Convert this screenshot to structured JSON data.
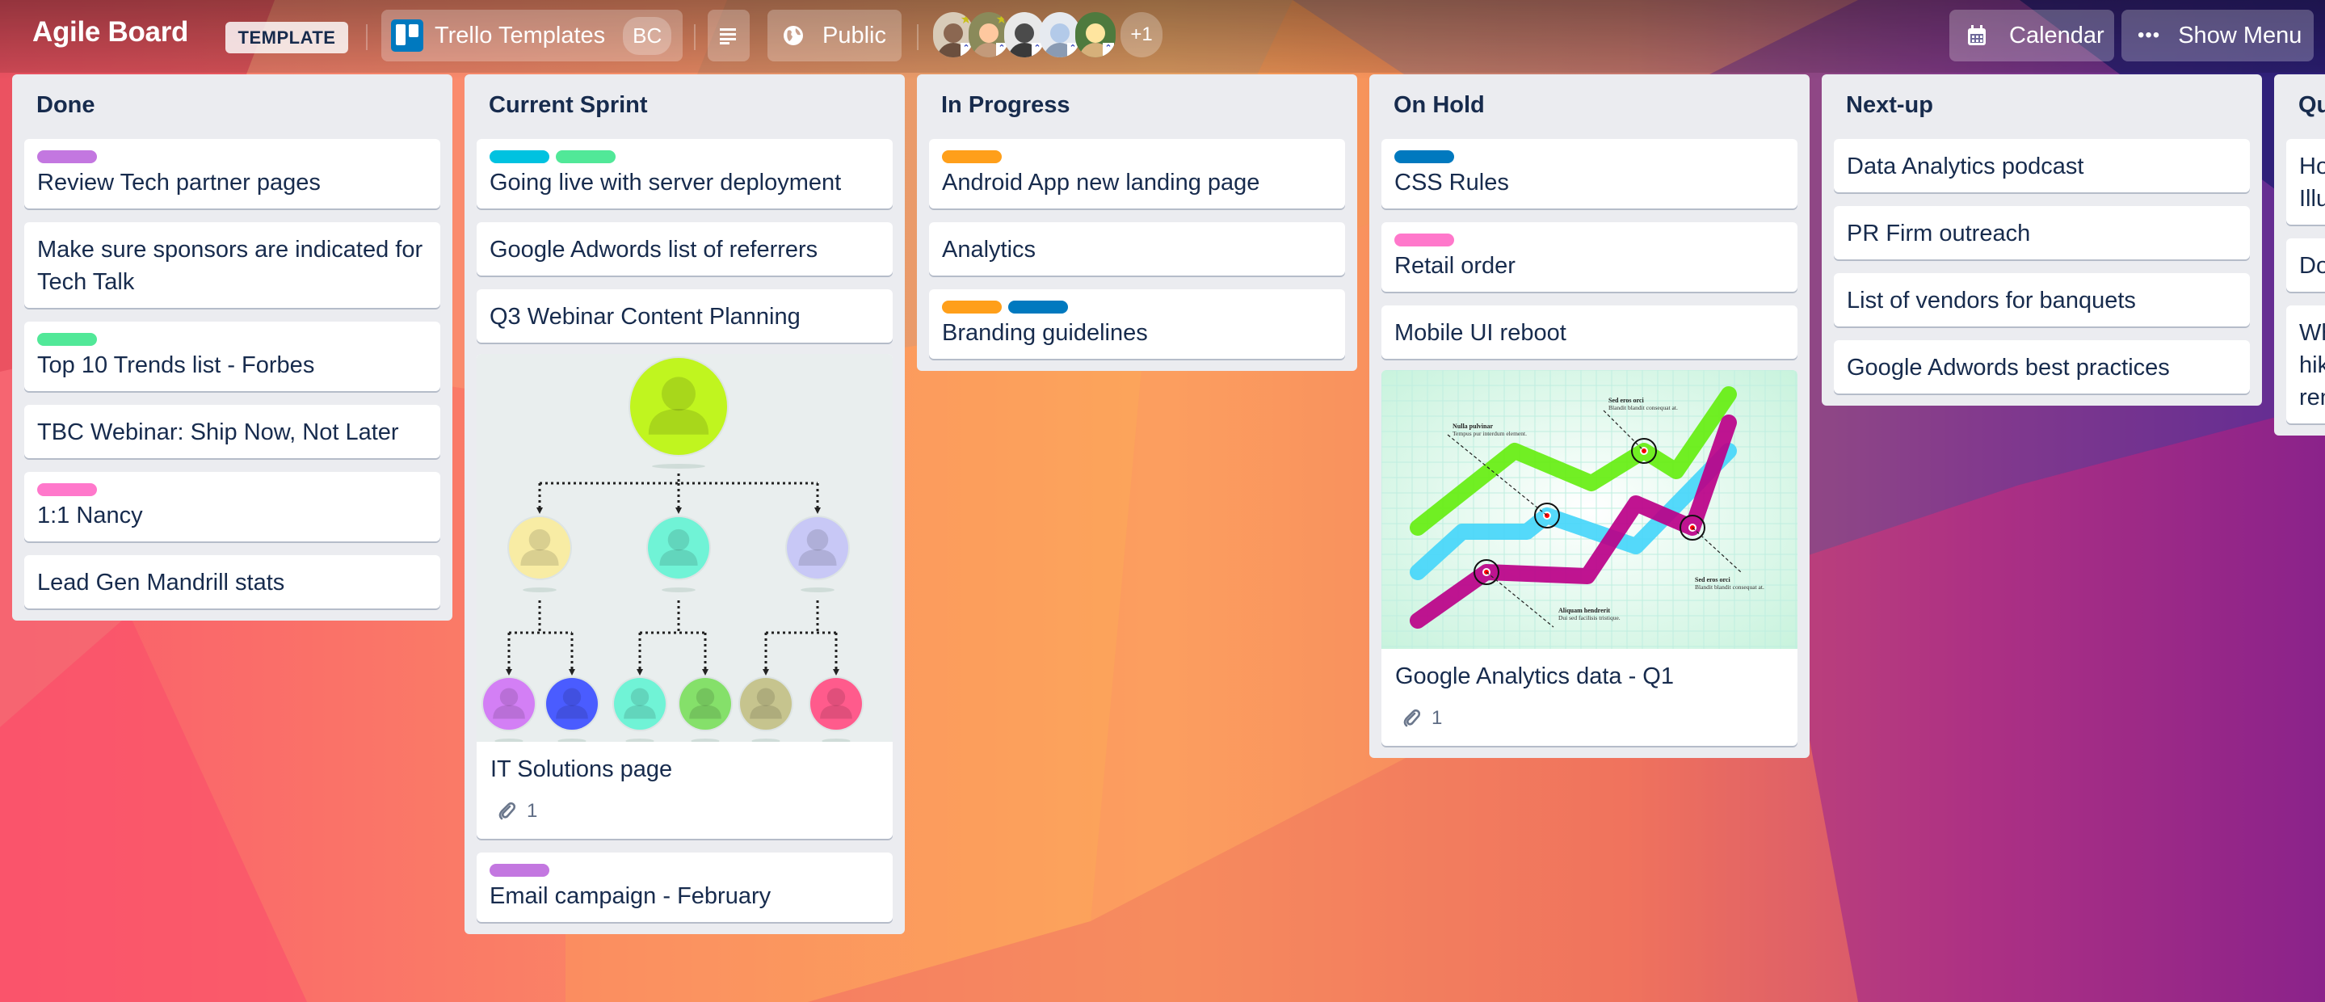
{
  "header": {
    "board_title": "Agile Board",
    "template_badge": "TEMPLATE",
    "workspace": {
      "name": "Trello Templates",
      "badge": "BC",
      "icon": "trello-logo-icon"
    },
    "menu_icon": "list-lines-icon",
    "visibility": {
      "label": "Public",
      "icon": "globe-icon"
    },
    "members": [
      {
        "name": "member-1",
        "admin": true,
        "face_color": "#6b4f3e",
        "bg": "#d8cbb8"
      },
      {
        "name": "member-2",
        "admin": true,
        "face_color": "#c39a7a",
        "bg": "#8a8a5a"
      },
      {
        "name": "member-3",
        "admin": false,
        "face_color": "#3a3a3a",
        "bg": "#e8e8e8"
      },
      {
        "name": "member-4",
        "admin": false,
        "face_color": "#8a9bb3",
        "bg": "#e6eaf0"
      },
      {
        "name": "member-5",
        "admin": false,
        "face_color": "#d6b07a",
        "bg": "#4e7a3e"
      }
    ],
    "members_overflow": "+1",
    "calendar": {
      "label": "Calendar",
      "icon": "calendar-icon"
    },
    "show_menu": {
      "label": "Show Menu",
      "icon": "ellipsis-icon"
    }
  },
  "label_colors": {
    "purple": "#c377e0",
    "green": "#51e898",
    "sky": "#00c2e0",
    "orange": "#ff9f1a",
    "blue": "#0079bf",
    "pink": "#ff78cb"
  },
  "lists": [
    {
      "title": "Done",
      "cards": [
        {
          "title": "Review Tech partner pages",
          "labels": [
            "purple"
          ]
        },
        {
          "title": "Make sure sponsors are indicated for Tech Talk",
          "labels": []
        },
        {
          "title": "Top 10 Trends list - Forbes",
          "labels": [
            "green"
          ]
        },
        {
          "title": "TBC Webinar: Ship Now, Not Later",
          "labels": []
        },
        {
          "title": "1:1 Nancy",
          "labels": [
            "pink"
          ]
        },
        {
          "title": "Lead Gen Mandrill stats",
          "labels": []
        }
      ]
    },
    {
      "title": "Current Sprint",
      "cards": [
        {
          "title": "Going live with server deployment",
          "labels": [
            "sky",
            "green"
          ]
        },
        {
          "title": "Google Adwords list of referrers",
          "labels": []
        },
        {
          "title": "Q3 Webinar Content Planning",
          "labels": []
        },
        {
          "title": "IT Solutions page",
          "labels": [],
          "cover": "org-chart",
          "attachments": "1"
        },
        {
          "title": "Email campaign - February",
          "labels": [
            "purple"
          ]
        }
      ]
    },
    {
      "title": "In Progress",
      "cards": [
        {
          "title": "Android App new landing page",
          "labels": [
            "orange"
          ]
        },
        {
          "title": "Analytics",
          "labels": []
        },
        {
          "title": "Branding guidelines",
          "labels": [
            "orange",
            "blue"
          ]
        }
      ]
    },
    {
      "title": "On Hold",
      "cards": [
        {
          "title": "CSS Rules",
          "labels": [
            "blue"
          ]
        },
        {
          "title": "Retail order",
          "labels": [
            "pink"
          ]
        },
        {
          "title": "Mobile UI reboot",
          "labels": []
        },
        {
          "title": "Google Analytics data - Q1",
          "labels": [],
          "cover": "line-chart",
          "attachments": "1"
        }
      ]
    },
    {
      "title": "Next-up",
      "cards": [
        {
          "title": "Data Analytics podcast",
          "labels": []
        },
        {
          "title": "PR Firm outreach",
          "labels": []
        },
        {
          "title": "List of vendors for banquets",
          "labels": []
        },
        {
          "title": "Google Adwords best practices",
          "labels": []
        }
      ]
    },
    {
      "title": "Qu",
      "partial": true,
      "cards": [
        {
          "title": "Ho Illu",
          "labels": []
        },
        {
          "title": "Do",
          "labels": []
        },
        {
          "title": "Wh hik ren",
          "labels": []
        }
      ]
    }
  ],
  "cover_chart_annotations": [
    {
      "title": "Nulla pulvinar",
      "text": "Tempus pur interdum element."
    },
    {
      "title": "Sed eros orci",
      "text": "Blandit blandit consequat at."
    },
    {
      "title": "Sed eros orci",
      "text": "Blandit blandit consequat at."
    },
    {
      "title": "Aliquam hendrerit",
      "text": "Dui sed facilisis tristique."
    }
  ],
  "org_chart_colors": {
    "root": "#c0f51f",
    "level2": [
      "#f8eca4",
      "#70f3d6",
      "#c8c8f6"
    ],
    "level3": [
      "#d37ff5",
      "#4a5cff",
      "#70f3d6",
      "#85e06a",
      "#c6c48e",
      "#ff5b8c"
    ]
  }
}
